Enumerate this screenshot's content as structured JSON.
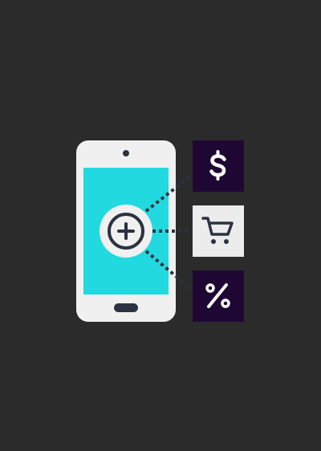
{
  "colors": {
    "background": "#2b2b2b",
    "phone_body": "#f0f0f0",
    "phone_screen": "#22d9df",
    "dark_navy": "#2b3341",
    "tile_purple": "#1f0733",
    "tile_light": "#ececec",
    "icon_white": "#ffffff"
  },
  "icons": {
    "plus_button": "plus-circle-icon",
    "dollar_tile": "dollar-icon",
    "cart_tile": "shopping-cart-icon",
    "percent_tile": "percent-icon"
  }
}
